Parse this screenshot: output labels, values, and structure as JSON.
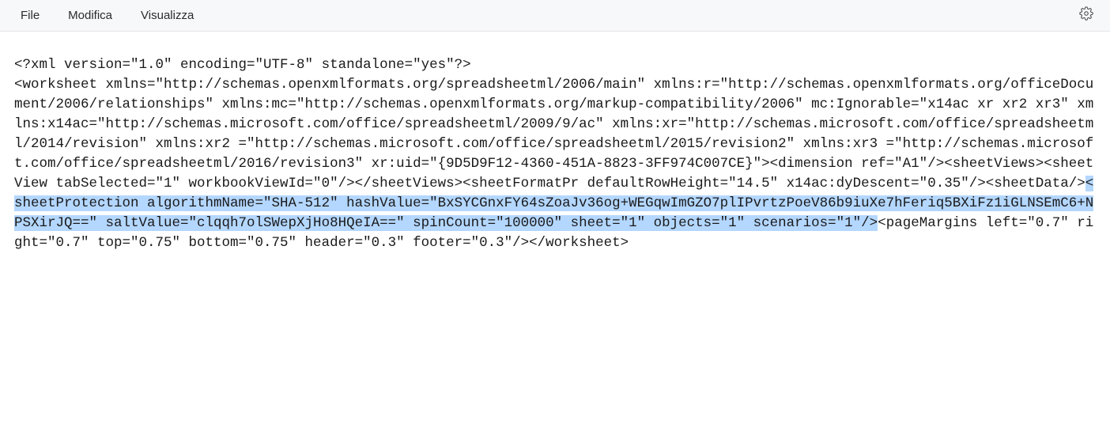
{
  "menubar": {
    "file": "File",
    "edit": "Modifica",
    "view": "Visualizza"
  },
  "xml": {
    "pre1": "<?xml version=\"1.0\" encoding=\"UTF-8\" standalone=\"yes\"?>\n<worksheet xmlns=\"http://schemas.openxmlformats.org/spreadsheetml/2006/main\" xmlns:r=\"http://schemas.openxmlformats.org/officeDocument/2006/relationships\" xmlns:mc=\"http://schemas.openxmlformats.org/markup-compatibility/2006\" mc:Ignorable=\"x14ac xr xr2 xr3\" xmlns:x14ac=\"http://schemas.microsoft.com/office/spreadsheetml/2009/9/ac\" xmlns:xr=\"http://schemas.microsoft.com/office/spreadsheetml/2014/revision\" xmlns:xr2 =\"http://schemas.microsoft.com/office/spreadsheetml/2015/revision2\" xmlns:xr3 =\"http://schemas.microsoft.com/office/spreadsheetml/2016/revision3\" xr:uid=\"{9D5D9F12-4360-451A-8823-3FF974C007CE}\"><dimension ref=\"A1\"/><sheetViews><sheetView tabSelected=\"1\" workbookViewId=\"0\"/></sheetViews><sheetFormatPr defaultRowHeight=\"14.5\" x14ac:dyDescent=\"0.35\"/><sheetData/>",
    "selected": "<sheetProtection algorithmName=\"SHA-512\" hashValue=\"BxSYCGnxFY64sZoaJv36og+WEGqwImGZO7plIPvrtzPoeV86b9iuXe7hFeriq5BXiFz1iGLNSEmC6+NPSXirJQ==\" saltValue=\"clqqh7olSWepXjHo8HQeIA==\" spinCount=\"100000\" sheet=\"1\" objects=\"1\" scenarios=\"1\"/>",
    "post1": "<pageMargins left=\"0.7\" right=\"0.7\" top=\"0.75\" bottom=\"0.75\" header=\"0.3\" footer=\"0.3\"/></worksheet>"
  }
}
